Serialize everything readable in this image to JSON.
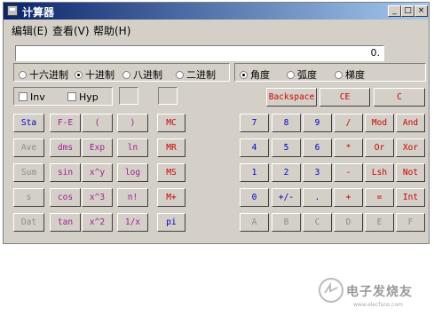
{
  "window": {
    "title": "计算器",
    "controls": [
      "_",
      "□",
      "×"
    ]
  },
  "menubar": {
    "items": [
      "编辑(E)",
      "查看(V)",
      "帮助(H)"
    ]
  },
  "display": {
    "value": "0."
  },
  "base_modes": {
    "options": [
      "十六进制",
      "十进制",
      "八进制",
      "二进制"
    ],
    "selected": "十进制"
  },
  "angle_modes": {
    "options": [
      "角度",
      "弧度",
      "梯度"
    ],
    "selected": "角度"
  },
  "checkboxes": {
    "inv": "Inv",
    "hyp": "Hyp"
  },
  "edit_buttons": {
    "backspace": "Backspace",
    "ce": "CE",
    "c": "C"
  },
  "scientific_buttons": [
    [
      "Sta",
      "F-E",
      "(",
      ")"
    ],
    [
      "Ave",
      "dms",
      "Exp",
      "ln"
    ],
    [
      "Sum",
      "sin",
      "x^y",
      "log"
    ],
    [
      "s",
      "cos",
      "x^3",
      "n!"
    ],
    [
      "Dat",
      "tan",
      "x^2",
      "1/x"
    ]
  ],
  "memory_buttons": [
    "MC",
    "MR",
    "MS",
    "M+",
    "pi"
  ],
  "keypad_buttons": [
    [
      "7",
      "8",
      "9",
      "/",
      "Mod",
      "And"
    ],
    [
      "4",
      "5",
      "6",
      "*",
      "Or",
      "Xor"
    ],
    [
      "1",
      "2",
      "3",
      "-",
      "Lsh",
      "Not"
    ],
    [
      "0",
      "+/-",
      ".",
      "+",
      "=",
      "Int"
    ],
    [
      "A",
      "B",
      "C",
      "D",
      "E",
      "F"
    ]
  ],
  "watermark": {
    "text": "电子发烧友",
    "url": "www.elecfans.com"
  },
  "colors": {
    "titlebar": "#0a246a",
    "face": "#d4d0c8",
    "blue": "#0000cc",
    "red": "#cc0000",
    "purple": "#a02090",
    "disabled": "#8c8c8c"
  }
}
